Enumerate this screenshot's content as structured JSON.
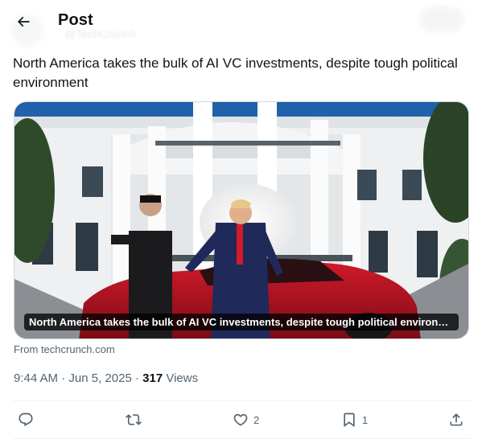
{
  "header": {
    "title": "Post",
    "faded_handle": "@TechCrunch"
  },
  "post": {
    "text": "North America takes the bulk of AI VC investments, despite tough political environment"
  },
  "card": {
    "caption": "North America takes the bulk of AI VC investments, despite tough political environmen...",
    "source": "From techcrunch.com"
  },
  "meta": {
    "time": "9:44 AM",
    "sep1": " · ",
    "date": "Jun 5, 2025",
    "sep2": " · ",
    "views_count": "317",
    "views_label": " Views"
  },
  "actions": {
    "reply_icon": "reply-icon",
    "repost_icon": "repost-icon",
    "like_icon": "heart-icon",
    "like_count": "2",
    "bookmark_icon": "bookmark-icon",
    "bookmark_count": "1",
    "share_icon": "share-icon"
  },
  "colors": {
    "text_primary": "#0f1419",
    "text_secondary": "#536471",
    "border": "#cfd9de",
    "divider": "#eff3f4"
  }
}
